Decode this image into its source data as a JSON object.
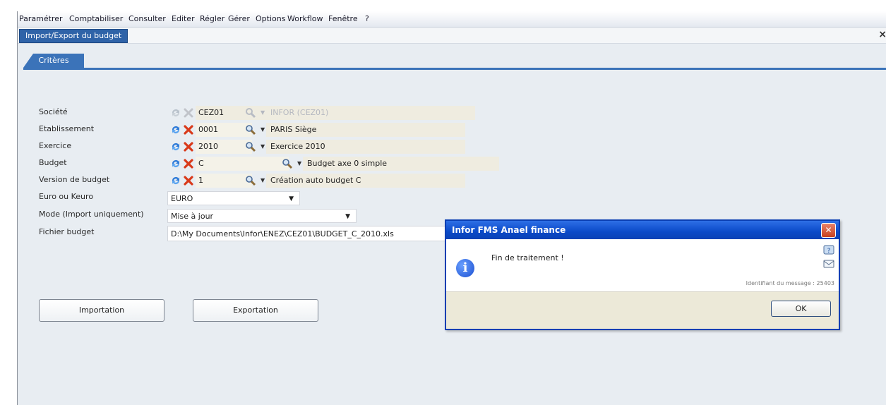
{
  "menu": {
    "items": [
      "Paramétrer",
      "Comptabiliser",
      "Consulter",
      "Editer",
      "Régler",
      "Gérer",
      "Options",
      "Workflow",
      "Fenêtre",
      "?"
    ]
  },
  "window": {
    "tab_label": "Import/Export du budget",
    "close_glyph": "×"
  },
  "subtabs": {
    "criteria_label": "Critères"
  },
  "form": {
    "societe": {
      "label": "Société",
      "code": "CEZ01",
      "desc": "INFOR (CEZ01)"
    },
    "etablissement": {
      "label": "Etablissement",
      "code": "0001",
      "desc": "PARIS  Siège"
    },
    "exercice": {
      "label": "Exercice",
      "code": "2010",
      "desc": "Exercice 2010"
    },
    "budget": {
      "label": "Budget",
      "code": "C",
      "desc": "Budget axe 0 simple"
    },
    "version": {
      "label": "Version de budget",
      "code": "1",
      "desc": "Création auto budget C"
    },
    "euro": {
      "label": "Euro ou Keuro",
      "value": "EURO"
    },
    "mode": {
      "label": "Mode (Import uniquement)",
      "value": "Mise à jour"
    },
    "fichier": {
      "label": "Fichier budget",
      "value": "D:\\My Documents\\Infor\\ENEZ\\CEZ01\\BUDGET_C_2010.xls"
    }
  },
  "buttons": {
    "import_label": "Importation",
    "export_label": "Exportation"
  },
  "dialog": {
    "title": "Infor FMS Anael finance",
    "message": "Fin de traitement !",
    "identifier": "Identifiant du message : 25403",
    "ok_label": "OK"
  },
  "colors": {
    "accent": "#3b73b9",
    "dialog_title": "#0a49c8",
    "delete_red": "#d93a1a"
  }
}
